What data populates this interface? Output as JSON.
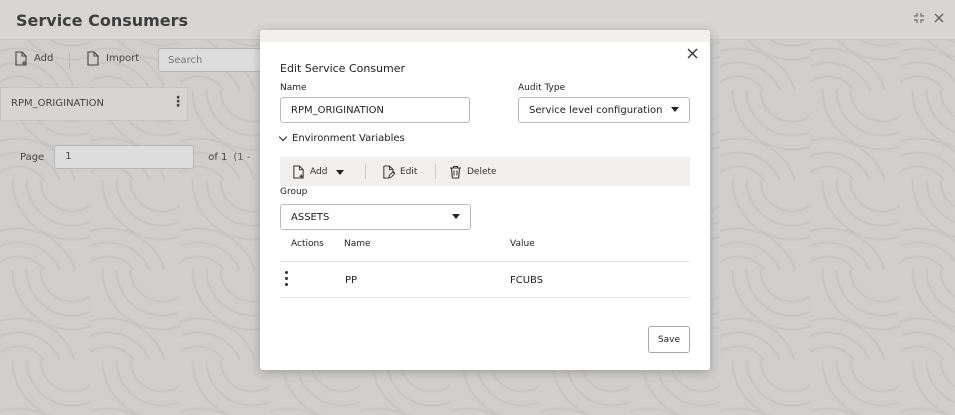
{
  "page": {
    "title": "Service Consumers",
    "window_icons": [
      "collapse-icon",
      "close-icon"
    ]
  },
  "toolbar": {
    "add_label": "Add",
    "import_label": "Import",
    "search_placeholder": "Search"
  },
  "list": {
    "items": [
      {
        "label": "RPM_ORIGINATION"
      }
    ]
  },
  "pager": {
    "page_label": "Page",
    "page_value": "1",
    "of_text": "of 1",
    "range_text": "(1 -"
  },
  "modal": {
    "title": "Edit Service Consumer",
    "name_label": "Name",
    "name_value": "RPM_ORIGINATION",
    "audit_label": "Audit Type",
    "audit_value": "Service level configuration",
    "env_section_label": "Environment Variables",
    "env_toolbar": {
      "add_label": "Add",
      "edit_label": "Edit",
      "delete_label": "Delete"
    },
    "group_label": "Group",
    "group_value": "ASSETS",
    "table": {
      "headers": [
        "Actions",
        "Name",
        "Value"
      ],
      "rows": [
        {
          "name": "PP",
          "value": "FCUBS"
        }
      ]
    },
    "save_label": "Save"
  }
}
